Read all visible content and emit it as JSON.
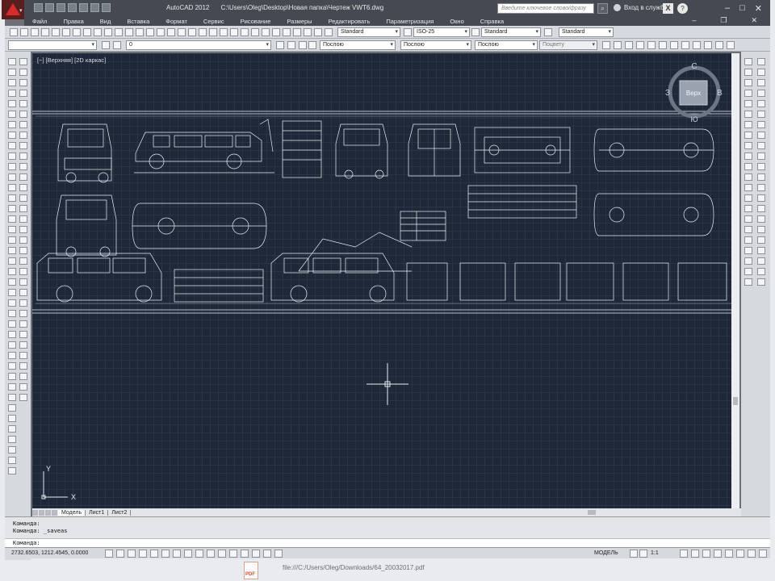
{
  "app": {
    "title": "AutoCAD 2012",
    "file_path": "C:\\Users\\Oleg\\Desktop\\Новая папка\\Чертеж VWT6.dwg",
    "search_placeholder": "Введите ключевое слово/фразу",
    "sign_in": "Вход в службы"
  },
  "menu": [
    "Файл",
    "Правка",
    "Вид",
    "Вставка",
    "Формат",
    "Сервис",
    "Рисование",
    "Размеры",
    "Редактировать",
    "Параметризация",
    "Окно",
    "Справка"
  ],
  "toolbar1": {
    "text_style": "Standard",
    "dim_style": "ISO-25",
    "table_style": "Standard",
    "mleader_style": "Standard"
  },
  "toolbar2": {
    "layer": "0",
    "color": "Послою",
    "linetype": "Послою",
    "lineweight": "Послою",
    "plotstyle": "Поцвету"
  },
  "viewport": {
    "label": "[−] [Верхняя] [2D каркас]",
    "viewcube": {
      "top": "Верх",
      "north": "С",
      "west": "З",
      "east": "В",
      "south": "Ю"
    },
    "ucs": {
      "x": "X",
      "y": "Y"
    }
  },
  "tabs": [
    {
      "label": "Модель",
      "active": true
    },
    {
      "label": "Лист1",
      "active": false
    },
    {
      "label": "Лист2",
      "active": false
    }
  ],
  "command": {
    "history": [
      "Команда:",
      "Команда: _saveas"
    ],
    "prompt": "Команда:"
  },
  "status": {
    "coordinates": "2732.6503, 1212.4545, 0.0000",
    "model": "МОДЕЛЬ",
    "scale": "1:1"
  },
  "download": {
    "path": "file:///C:/Users/Oleg/Downloads/64_20032017.pdf",
    "pdf_icon_label": "PDF"
  },
  "colors": {
    "viewport_bg": "#1f2838",
    "title_bg": "#454a52",
    "drawing_line": "#e8eef5",
    "accent_red": "#d92b2b"
  }
}
